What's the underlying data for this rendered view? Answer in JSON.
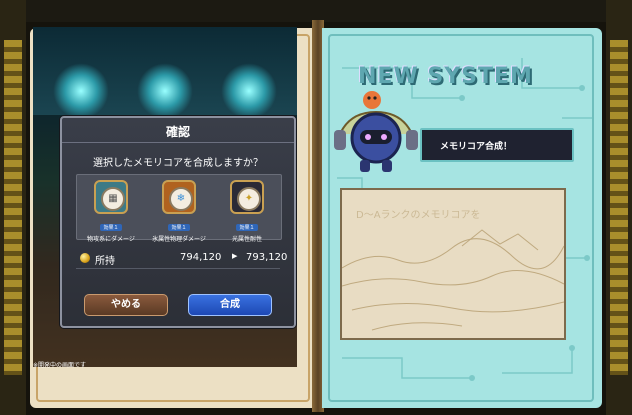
{
  "dialog": {
    "title": "確認",
    "message": "選択したメモリコアを合成しますか？",
    "cores": [
      {
        "badge": "効果１",
        "label": "物攻系にダメージ",
        "icon": "wall-shield-icon",
        "frame_color": "#3d7a86"
      },
      {
        "badge": "効果１",
        "label": "氷属性物理ダメージ",
        "icon": "ice-flower-icon",
        "frame_color": "#b0621f"
      },
      {
        "badge": "効果１",
        "label": "光属性耐性",
        "icon": "light-star-icon",
        "frame_color": "#2a2a36"
      }
    ],
    "owned": {
      "label": "所持",
      "from": "794,120",
      "arrow": "▶",
      "to": "793,120"
    },
    "cancel_label": "やめる",
    "confirm_label": "合成"
  },
  "right_page": {
    "heading": "NEW SYSTEM",
    "caption": "メモリコア合成！",
    "art_text": "D～Aランクのメモリコアを"
  },
  "footnote": "※開発中の画面です",
  "colors": {
    "page_cyan": "#a6e4e2",
    "page_parchment": "#ece0c4",
    "confirm_blue": "#2a5fd0",
    "cancel_brown": "#7a4d33"
  }
}
